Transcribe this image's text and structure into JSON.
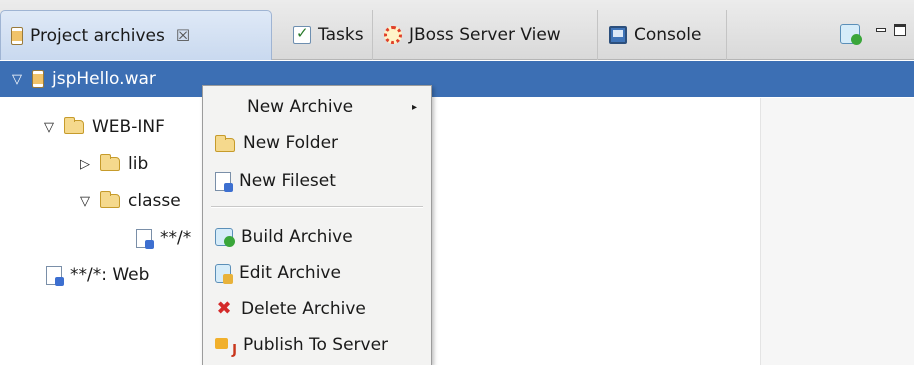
{
  "tabs": [
    {
      "label": "Project archives",
      "icon": "archive-icon",
      "active": true,
      "close": "☒"
    },
    {
      "label": "Tasks",
      "icon": "tasks-icon"
    },
    {
      "label": "JBoss Server View",
      "icon": "jboss-icon"
    },
    {
      "label": "Console",
      "icon": "console-icon"
    }
  ],
  "toolbar": {
    "build_icon": "build-archive-icon"
  },
  "tree": [
    {
      "label": "jspHello.war",
      "icon": "archive-icon",
      "twisty": "▽",
      "selected": true
    },
    {
      "label": "WEB-INF",
      "icon": "folder-icon",
      "twisty": "▽"
    },
    {
      "label": "lib",
      "icon": "folder-icon",
      "twisty": "▷"
    },
    {
      "label": "classe",
      "icon": "folder-icon",
      "twisty": "▽"
    },
    {
      "label": "**/*",
      "icon": "fileset-icon"
    },
    {
      "label": "**/*: Web",
      "icon": "fileset-icon"
    }
  ],
  "context_menu": {
    "items": [
      {
        "label": "New Archive",
        "submenu_arrow": "▸"
      },
      {
        "label": "New Folder",
        "icon": "folder-icon"
      },
      {
        "label": "New Fileset",
        "icon": "fileset-icon"
      },
      {
        "label": "Build Archive",
        "icon": "build-archive-icon"
      },
      {
        "label": "Edit Archive",
        "icon": "edit-archive-icon"
      },
      {
        "label": "Delete Archive",
        "icon": "delete-icon",
        "glyph": "✖"
      },
      {
        "label": "Publish To Server",
        "icon": "publish-icon"
      }
    ]
  },
  "colors": {
    "selection": "#3c6fb4",
    "tab_active": "#c9d9ef",
    "menu_bg": "#f3f3f2"
  }
}
